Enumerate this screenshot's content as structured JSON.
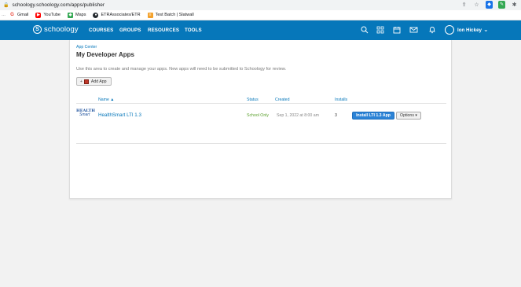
{
  "browser": {
    "url": "schoology.schoology.com/apps/publisher",
    "bookmarks": [
      {
        "label": "Gmail",
        "icon": "gmail-icon",
        "color": "#ea4335"
      },
      {
        "label": "YouTube",
        "icon": "youtube-icon",
        "color": "#ff0000"
      },
      {
        "label": "Maps",
        "icon": "maps-icon",
        "color": "#34a853"
      },
      {
        "label": "ETRAssociates/ETR",
        "icon": "github-icon",
        "color": "#24292e"
      },
      {
        "label": "Test Batch | Slatwall",
        "icon": "slatwall-icon",
        "color": "#f4a12b"
      }
    ]
  },
  "nav": {
    "logo": "schoology",
    "links": [
      "COURSES",
      "GROUPS",
      "RESOURCES",
      "TOOLS"
    ],
    "user_name": "Ion Hickey",
    "brand_color": "#0677ba"
  },
  "page": {
    "breadcrumb": "App Center",
    "title": "My Developer Apps",
    "description": "Use this area to create and manage your apps. New apps will need to be submitted to Schoology for review.",
    "add_button": "Add App"
  },
  "table": {
    "headers": {
      "name": "Name ▲",
      "status": "Status",
      "created": "Created",
      "installs": "Installs"
    },
    "rows": [
      {
        "logo_line1": "HEALTH",
        "logo_line2": "Smart",
        "name": "HealthSmart LTI 1.3",
        "status": "School Only",
        "created": "Sep 1, 2022 at 8:00 am",
        "installs": "3",
        "install_label": "Install LTI 1.3 App",
        "options_label": "Options ▾"
      }
    ]
  }
}
